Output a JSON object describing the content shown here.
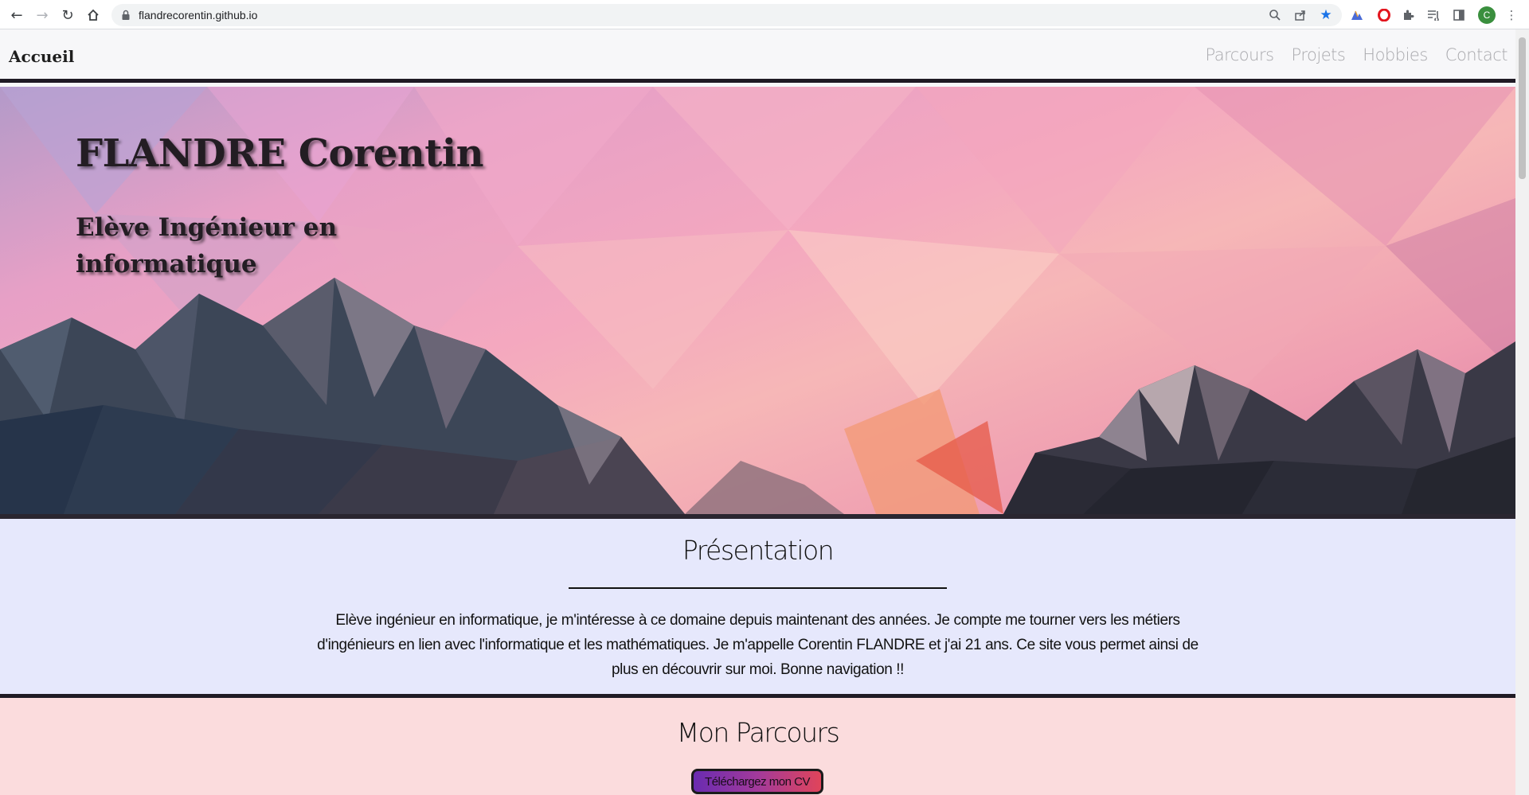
{
  "browser": {
    "url": "flandrecorentin.github.io",
    "profile_initial": "C",
    "icons": [
      "back-icon",
      "forward-icon",
      "reload-icon",
      "home-icon",
      "lock-icon",
      "zoom-icon",
      "share-icon",
      "bookmark-star-icon",
      "extension-icon",
      "opera-icon",
      "puzzle-icon",
      "reading-list-icon",
      "side-panel-icon",
      "menu-icon"
    ]
  },
  "nav": {
    "brand": "Accueil",
    "links": [
      "Parcours",
      "Projets",
      "Hobbies",
      "Contact"
    ]
  },
  "hero": {
    "title": "FLANDRE Corentin",
    "subtitle": "Elève Ingénieur en informatique"
  },
  "presentation": {
    "title": "Présentation",
    "text": "Elève ingénieur en informatique, je m'intéresse à ce domaine depuis maintenant des années. Je compte me tourner vers les métiers d'ingénieurs en lien avec l'informatique et les mathématiques. Je m'appelle Corentin FLANDRE et j'ai 21 ans. Ce site vous permet ainsi de plus en découvrir sur moi. Bonne navigation !!"
  },
  "parcours": {
    "title": "Mon Parcours",
    "cv_button": "Téléchargez mon CV"
  },
  "colors": {
    "presentation_bg": "#e6e8fc",
    "parcours_bg": "#fbdcdd",
    "border_dark": "#1f1a24"
  }
}
